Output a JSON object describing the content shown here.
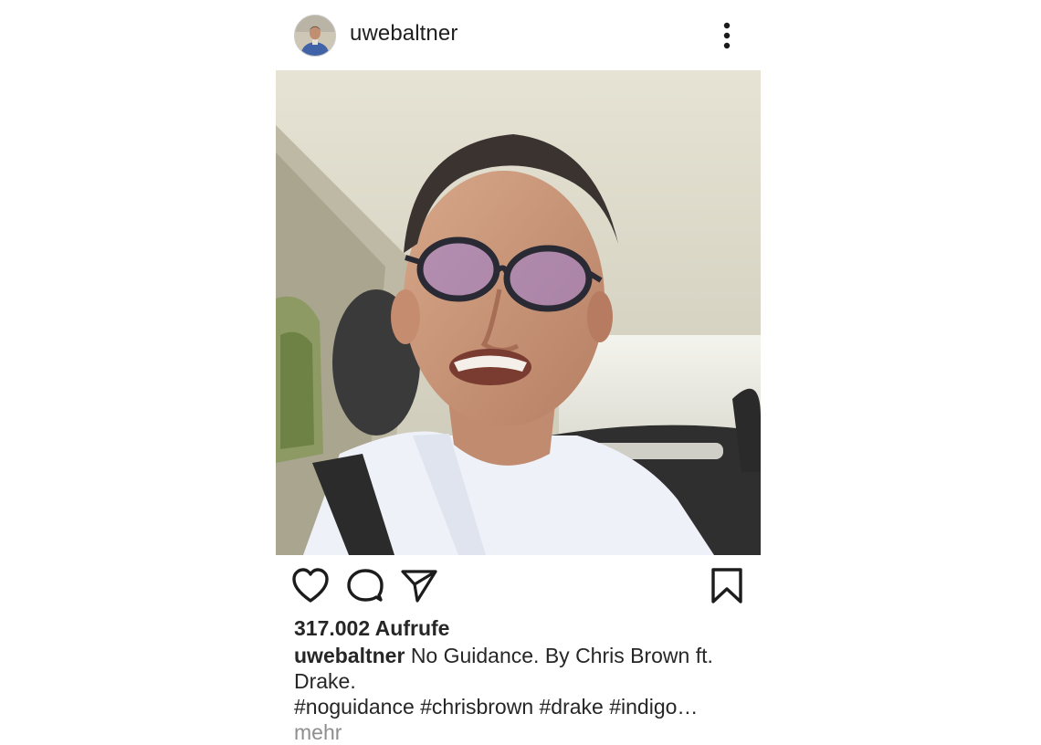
{
  "post": {
    "username": "uwebaltner",
    "views": "317.002 Aufrufe",
    "caption": {
      "username": "uwebaltner",
      "text": "No Guidance. By Chris Brown ft. Drake.",
      "hashtags": "#noguidance #chrisbrown #drake #indigo…",
      "more_label": "mehr"
    },
    "icons": {
      "more_options": "more-vertical-icon",
      "like": "heart-icon",
      "comment": "comment-icon",
      "share": "send-icon",
      "save": "bookmark-icon"
    }
  }
}
